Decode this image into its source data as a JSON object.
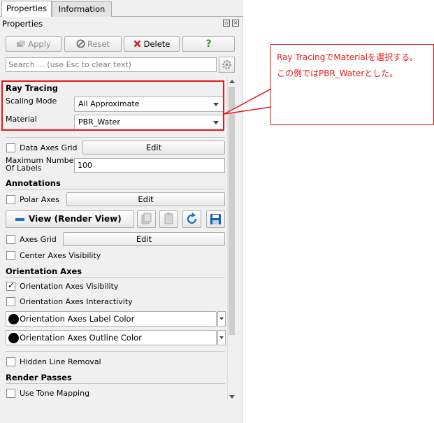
{
  "tabs": [
    {
      "label": "Properties",
      "active": true
    },
    {
      "label": "Information",
      "active": false
    }
  ],
  "panel_title": "Properties",
  "toolbar": {
    "apply_label": "Apply",
    "reset_label": "Reset",
    "delete_label": "Delete",
    "help_label": "?"
  },
  "search": {
    "placeholder": "Search ... (use Esc to clear text)"
  },
  "ray_tracing": {
    "section_title": "Ray Tracing",
    "scaling_mode_label": "Scaling Mode",
    "scaling_mode_value": "All Approximate",
    "material_label": "Material",
    "material_value": "PBR_Water"
  },
  "data_axes_grid": {
    "label": "Data Axes Grid",
    "checked": false,
    "edit_label": "Edit"
  },
  "max_labels": {
    "label_line1": "Maximum Number",
    "label_line2": "Of Labels",
    "value": "100"
  },
  "annotations": {
    "section_title": "Annotations",
    "polar_axes_label": "Polar Axes",
    "polar_axes_checked": false,
    "edit_label": "Edit"
  },
  "view": {
    "label": "View (Render View)"
  },
  "axes_grid": {
    "label": "Axes Grid",
    "checked": false,
    "edit_label": "Edit"
  },
  "center_axes": {
    "label": "Center Axes Visibility",
    "checked": false
  },
  "orientation_axes": {
    "section_title": "Orientation Axes",
    "visibility_label": "Orientation Axes Visibility",
    "visibility_checked": true,
    "interactivity_label": "Orientation Axes Interactivity",
    "interactivity_checked": false,
    "label_color": "Orientation Axes Label Color",
    "outline_color": "Orientation Axes Outline Color"
  },
  "hidden_line": {
    "label": "Hidden Line Removal",
    "checked": false
  },
  "render_passes": {
    "section_title": "Render Passes",
    "tone_mapping_label": "Use Tone Mapping",
    "tone_mapping_checked": false
  },
  "callout": {
    "line1": "Ray TracingでMaterialを選択する。",
    "line2": "この例ではPBR_Waterとした。"
  },
  "colors": {
    "highlight": "#e8151b",
    "delete_icon": "#d9141b",
    "help_icon": "#2f9a24",
    "view_bar": "#1a73c8"
  }
}
